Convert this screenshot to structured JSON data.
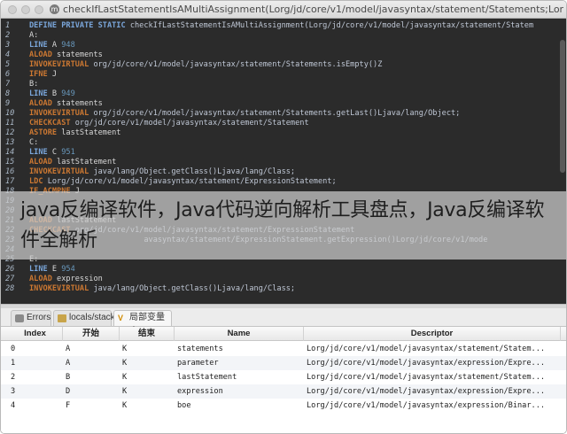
{
  "window": {
    "title": "checkIfLastStatementIsAMultiAssignment(Lorg/jd/core/v1/model/javasyntax/statement/Statements;Lorg/jd/core/v1/model/javasyntax/s"
  },
  "code_lines": [
    {
      "n": "1",
      "parts": [
        [
          "kw",
          "DEFINE PRIVATE STATIC"
        ],
        [
          "id",
          " checkIfLastStatementIsAMultiAssignment(Lorg/jd/core/v1/model/javasyntax/statement/Statem"
        ]
      ]
    },
    {
      "n": "2",
      "parts": [
        [
          "txt",
          "A:"
        ]
      ]
    },
    {
      "n": "3",
      "parts": [
        [
          "kw",
          "LINE"
        ],
        [
          "txt",
          " A "
        ],
        [
          "num",
          "948"
        ]
      ]
    },
    {
      "n": "4",
      "parts": [
        [
          "op",
          "ALOAD"
        ],
        [
          "txt",
          " statements"
        ]
      ]
    },
    {
      "n": "5",
      "parts": [
        [
          "op",
          "INVOKEVIRTUAL"
        ],
        [
          "id",
          " org/jd/core/v1/model/javasyntax/statement/Statements.isEmpty()Z"
        ]
      ]
    },
    {
      "n": "6",
      "parts": [
        [
          "op",
          "IFNE"
        ],
        [
          "txt",
          " J"
        ]
      ]
    },
    {
      "n": "7",
      "parts": [
        [
          "txt",
          "B:"
        ]
      ]
    },
    {
      "n": "8",
      "parts": [
        [
          "kw",
          "LINE"
        ],
        [
          "txt",
          " B "
        ],
        [
          "num",
          "949"
        ]
      ]
    },
    {
      "n": "9",
      "parts": [
        [
          "op",
          "ALOAD"
        ],
        [
          "txt",
          " statements"
        ]
      ]
    },
    {
      "n": "10",
      "parts": [
        [
          "op",
          "INVOKEVIRTUAL"
        ],
        [
          "id",
          " org/jd/core/v1/model/javasyntax/statement/Statements.getLast()Ljava/lang/Object;"
        ]
      ]
    },
    {
      "n": "11",
      "parts": [
        [
          "op",
          "CHECKCAST"
        ],
        [
          "id",
          " org/jd/core/v1/model/javasyntax/statement/Statement"
        ]
      ]
    },
    {
      "n": "12",
      "parts": [
        [
          "op",
          "ASTORE"
        ],
        [
          "txt",
          " lastStatement"
        ]
      ]
    },
    {
      "n": "13",
      "parts": [
        [
          "txt",
          "C:"
        ]
      ]
    },
    {
      "n": "14",
      "parts": [
        [
          "kw",
          "LINE"
        ],
        [
          "txt",
          " C "
        ],
        [
          "num",
          "951"
        ]
      ]
    },
    {
      "n": "15",
      "parts": [
        [
          "op",
          "ALOAD"
        ],
        [
          "txt",
          " lastStatement"
        ]
      ]
    },
    {
      "n": "16",
      "parts": [
        [
          "op",
          "INVOKEVIRTUAL"
        ],
        [
          "id",
          " java/lang/Object.getClass()Ljava/lang/Class;"
        ]
      ]
    },
    {
      "n": "17",
      "parts": [
        [
          "op",
          "LDC"
        ],
        [
          "id",
          " Lorg/jd/core/v1/model/javasyntax/statement/ExpressionStatement;"
        ]
      ]
    },
    {
      "n": "18",
      "parts": [
        [
          "op",
          "IF_ACMPNE"
        ],
        [
          "txt",
          " J"
        ]
      ]
    },
    {
      "n": "19",
      "parts": [
        [
          "txt",
          ""
        ]
      ]
    },
    {
      "n": "20",
      "parts": [
        [
          "txt",
          ""
        ]
      ]
    },
    {
      "n": "21",
      "parts": [
        [
          "op",
          "ALOAD"
        ],
        [
          "txt",
          " lastStatement"
        ]
      ]
    },
    {
      "n": "22",
      "parts": [
        [
          "op",
          "CHECKCAST"
        ],
        [
          "id",
          " org/jd/core/v1/model/javasyntax/statement/ExpressionStatement"
        ]
      ]
    },
    {
      "n": "23",
      "parts": [
        [
          "id",
          "                         avasyntax/statement/ExpressionStatement.getExpression()Lorg/jd/core/v1/mode"
        ]
      ]
    },
    {
      "n": "24",
      "parts": [
        [
          "txt",
          ""
        ]
      ]
    },
    {
      "n": "25",
      "parts": [
        [
          "txt",
          "E:"
        ]
      ]
    },
    {
      "n": "26",
      "parts": [
        [
          "kw",
          "LINE"
        ],
        [
          "txt",
          " E "
        ],
        [
          "num",
          "954"
        ]
      ]
    },
    {
      "n": "27",
      "parts": [
        [
          "op",
          "ALOAD"
        ],
        [
          "txt",
          " expression"
        ]
      ]
    },
    {
      "n": "28",
      "parts": [
        [
          "op",
          "INVOKEVIRTUAL"
        ],
        [
          "id",
          " java/lang/Object.getClass()Ljava/lang/Class;"
        ]
      ]
    }
  ],
  "overlay_text": "java反编译软件，Java代码逆向解析工具盘点，Java反编译软件全解析",
  "tabs": [
    {
      "label": "Errors",
      "icon": "errors-icon"
    },
    {
      "label": "locals/stack",
      "icon": "stack-icon"
    },
    {
      "label": "局部变量表",
      "icon": "variables-icon"
    }
  ],
  "table": {
    "headers": [
      "Index",
      "开始",
      "结束",
      "Name",
      "Descriptor"
    ],
    "rows": [
      [
        "0",
        "A",
        "K",
        "statements",
        "Lorg/jd/core/v1/model/javasyntax/statement/Statem..."
      ],
      [
        "1",
        "A",
        "K",
        "parameter",
        "Lorg/jd/core/v1/model/javasyntax/expression/Expre..."
      ],
      [
        "2",
        "B",
        "K",
        "lastStatement",
        "Lorg/jd/core/v1/model/javasyntax/statement/Statem..."
      ],
      [
        "3",
        "D",
        "K",
        "expression",
        "Lorg/jd/core/v1/model/javasyntax/expression/Expre..."
      ],
      [
        "4",
        "F",
        "K",
        "boe",
        "Lorg/jd/core/v1/model/javasyntax/expression/Binar..."
      ]
    ]
  }
}
